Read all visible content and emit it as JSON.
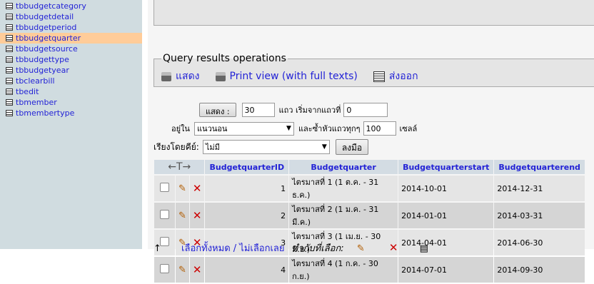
{
  "sidebar": {
    "items": [
      {
        "label": "tbbudgetcategory"
      },
      {
        "label": "tbbudgetdetail"
      },
      {
        "label": "tbbudgetperiod"
      },
      {
        "label": "tbbudgetquarter"
      },
      {
        "label": "tbbudgetsource"
      },
      {
        "label": "tbbudgettype"
      },
      {
        "label": "tbbudgetyear"
      },
      {
        "label": "tbclearbill"
      },
      {
        "label": "tbedit"
      },
      {
        "label": "tbmember"
      },
      {
        "label": "tbmembertype"
      }
    ],
    "active_index": 3,
    "active_color": "#ffcc99"
  },
  "ops": {
    "legend": "Query results operations",
    "show": "แสดง",
    "print": "Print view (with full texts)",
    "export": "ส่งออก"
  },
  "nav": {
    "show_button": "แสดง :",
    "rows_value": "30",
    "rows_from_label": "แถว เริ่มจากแถวที่",
    "start_value": "0",
    "in_label": "อยู่ใน",
    "mode_value": "แนวนอน",
    "repeat_label": "และซ้ำหัวแถวทุกๆ",
    "repeat_value": "100",
    "cells_label": "เซลล์"
  },
  "sort": {
    "label": "เรียงโดยคีย์:",
    "value": "ไม่มี",
    "go_button": "ลงมือ"
  },
  "table": {
    "headers": [
      "BudgetquarterID",
      "Budgetquarter",
      "Budgetquarterstart",
      "Budgetquarterend"
    ],
    "rows": [
      {
        "id": "1",
        "name": "ไตรมาสที่ 1 (1 ต.ค. - 31 ธ.ค.)",
        "start": "2014-10-01",
        "end": "2014-12-31"
      },
      {
        "id": "2",
        "name": "ไตรมาสที่ 2 (1 ม.ค. - 31 มี.ค.)",
        "start": "2014-01-01",
        "end": "2014-03-31"
      },
      {
        "id": "3",
        "name": "ไตรมาสที่ 3 (1 เม.ย. - 30 มิ.ย.)",
        "start": "2014-04-01",
        "end": "2014-06-30"
      },
      {
        "id": "4",
        "name": "ไตรมาสที่ 4 (1 ก.ค. - 30 ก.ย.)",
        "start": "2014-07-01",
        "end": "2014-09-30"
      }
    ]
  },
  "footer": {
    "select_all": "เลือกทั้งหมด / ไม่เลือกเลย",
    "with_selected": "ทำกับที่เลือก:"
  }
}
